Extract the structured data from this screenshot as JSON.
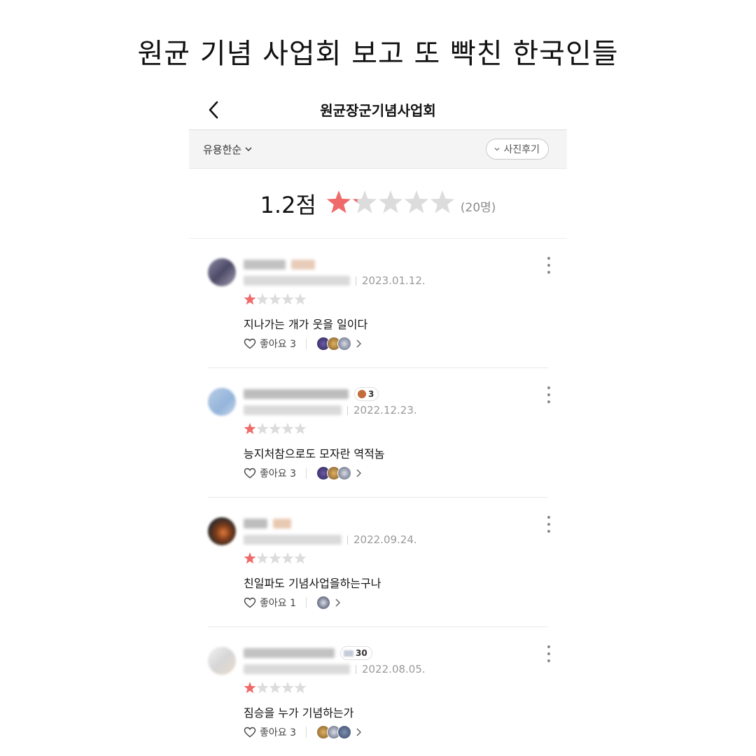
{
  "caption": "원균 기념 사업회 보고 또 빡친 한국인들",
  "header": {
    "title": "원균장군기념사업회"
  },
  "filters": {
    "sort_label": "유용한순",
    "photo_label": "사진후기"
  },
  "summary": {
    "score": "1.2점",
    "rating": 1.2,
    "max_rating": 5,
    "count": "(20명)"
  },
  "colors": {
    "star_filled": "#ef6a6a",
    "star_empty": "#dcdcdc"
  },
  "icons": {
    "back": "chevron-left-icon",
    "more": "more-vertical-icon",
    "like": "heart-outline-icon"
  },
  "reviews": [
    {
      "date": "2023.01.12.",
      "rating": 1,
      "text": "지나가는 개가 웃을 일이다",
      "likes": "좋아요 3",
      "badge": "",
      "photos": 3
    },
    {
      "date": "2022.12.23.",
      "rating": 1,
      "text": "능지처참으로도 모자란 역적놈",
      "likes": "좋아요 3",
      "badge": "3",
      "photos": 3
    },
    {
      "date": "2022.09.24.",
      "rating": 1,
      "text": "친일파도 기념사업을하는구나",
      "likes": "좋아요 1",
      "badge": "",
      "photos": 1
    },
    {
      "date": "2022.08.05.",
      "rating": 1,
      "text": "짐승을 누가 기념하는가",
      "likes": "좋아요 3",
      "badge": "30",
      "photos": 3
    }
  ]
}
